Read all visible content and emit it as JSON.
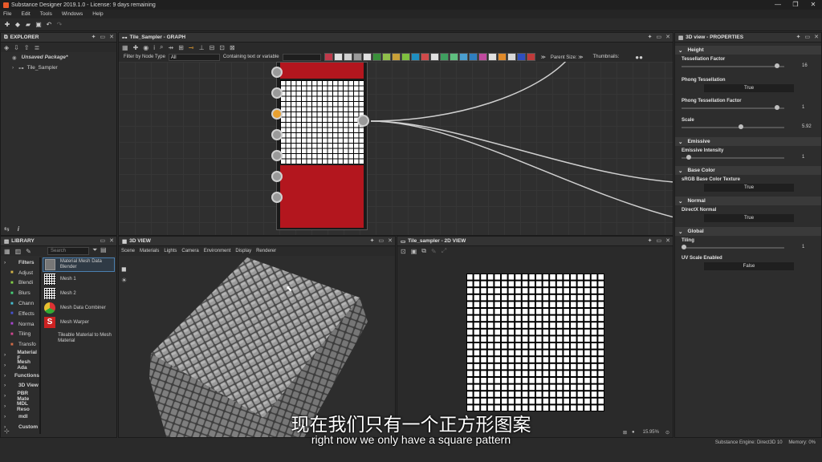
{
  "window": {
    "title": "Substance Designer 2019.1.0 - License: 9 days remaining",
    "controls": [
      "—",
      "❐",
      "✕"
    ]
  },
  "menu": [
    "File",
    "Edit",
    "Tools",
    "Windows",
    "Help"
  ],
  "explorer": {
    "title": "EXPLORER",
    "package": "Unsaved Package*",
    "graph": "Tile_Sampler"
  },
  "library": {
    "title": "LIBRARY",
    "search_placeholder": "Search",
    "categories": [
      {
        "label": "Filters",
        "bold": true
      },
      {
        "label": "Adjust"
      },
      {
        "label": "Blendi"
      },
      {
        "label": "Blurs"
      },
      {
        "label": "Chann"
      },
      {
        "label": "Effects"
      },
      {
        "label": "Norma"
      },
      {
        "label": "Tiling"
      },
      {
        "label": "Transfo"
      },
      {
        "label": "Material F",
        "bold": true
      },
      {
        "label": "Mesh Ada",
        "bold": true
      },
      {
        "label": "Functions",
        "bold": true
      },
      {
        "label": "3D View",
        "bold": true
      },
      {
        "label": "PBR Mate",
        "bold": true
      },
      {
        "label": "MDL Reso",
        "bold": true
      },
      {
        "label": "mdl",
        "bold": true
      },
      {
        "label": "Custom",
        "bold": true
      }
    ],
    "items": [
      "Material Mesh Data Blender",
      "Mesh 1",
      "Mesh 2",
      "Mesh Data Combiner",
      "Mesh Warper",
      "Tileable Material to Mesh Material"
    ]
  },
  "graph": {
    "title": "Tile_Sampler - GRAPH",
    "filter_label": "Filter by Node Type",
    "filter_value": "All",
    "containing_label": "Containing text or variable",
    "parent_size": "Parent Size: ≫",
    "thumbnails": "Thumbnails:",
    "palette_colors": [
      "#c0394a",
      "#e0e0e0",
      "#d0d0d0",
      "#9a9a9a",
      "#e0e0e0",
      "#3a8f3a",
      "#8fbf4a",
      "#c8a038",
      "#7fbf3f",
      "#1f8fc0",
      "#d04a4a",
      "#e0e0e0",
      "#3f9f5f",
      "#5fbf7f",
      "#4a9fd0",
      "#2f7fbf",
      "#c04a9f",
      "#e0e0e0",
      "#e08a2a",
      "#d8d8d8",
      "#2f4fbf",
      "#c03a3a"
    ]
  },
  "view3d": {
    "title": "3D VIEW",
    "menu": [
      "Scene",
      "Materials",
      "Lights",
      "Camera",
      "Environment",
      "Display",
      "Renderer"
    ]
  },
  "view2d": {
    "title": "Tile_sampler - 2D VIEW",
    "zoom": "15.95%",
    "grid_count": 20
  },
  "properties": {
    "title": "3D view - PROPERTIES",
    "sections": {
      "height": "Height",
      "emissive": "Emissive",
      "basecolor": "Base Color",
      "normal": "Normal",
      "global": "Global"
    },
    "tess_factor": {
      "label": "Tessellation Factor",
      "value": "16",
      "level": 0.95
    },
    "phong_tess": {
      "label": "Phong Tessellation",
      "value": "True"
    },
    "phong_factor": {
      "label": "Phong Tessellation Factor",
      "value": "1",
      "level": 0.95
    },
    "scale": {
      "label": "Scale",
      "value": "5.92",
      "level": 0.58
    },
    "emissive_intensity": {
      "label": "Emissive Intensity",
      "value": "1",
      "level": 0.05
    },
    "srgb": {
      "label": "sRGB Base Color Texture",
      "value": "True"
    },
    "directx": {
      "label": "DirectX Normal",
      "value": "True"
    },
    "tiling": {
      "label": "Tiling",
      "value": "1",
      "level": 0.0
    },
    "uv_scale": {
      "label": "UV Scale Enabled",
      "value": "False"
    }
  },
  "status": {
    "engine": "Substance Engine: Direct3D 10",
    "memory": "Memory: 0%"
  },
  "subtitles": {
    "cn": "现在我们只有一个正方形图案",
    "en": "right now we only have a square pattern"
  }
}
